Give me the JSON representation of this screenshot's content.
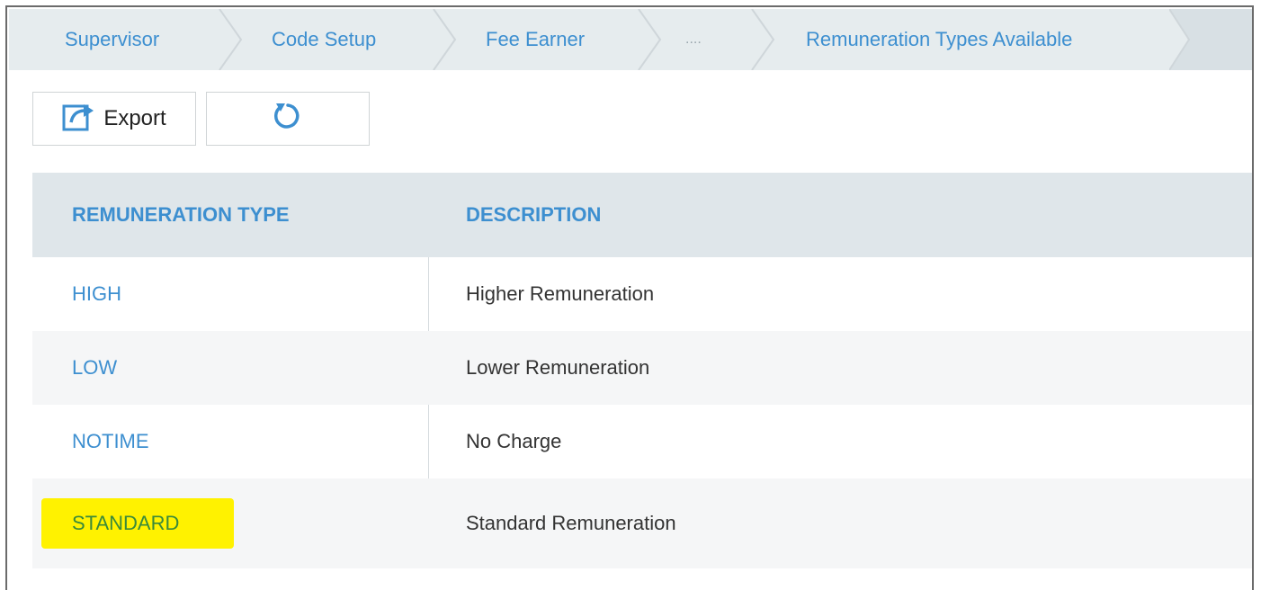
{
  "breadcrumb": {
    "items": [
      {
        "label": "Supervisor"
      },
      {
        "label": "Code Setup"
      },
      {
        "label": "Fee Earner"
      },
      {
        "label": "...."
      },
      {
        "label": "Remuneration Types Available"
      }
    ]
  },
  "toolbar": {
    "export_label": "Export",
    "export_icon": "export-icon",
    "refresh_icon": "refresh-icon"
  },
  "table": {
    "columns": [
      "REMUNERATION TYPE",
      "DESCRIPTION"
    ],
    "rows": [
      {
        "type": "HIGH",
        "description": "Higher Remuneration"
      },
      {
        "type": "LOW",
        "description": "Lower Remuneration"
      },
      {
        "type": "NOTIME",
        "description": "No Charge"
      },
      {
        "type": "STANDARD",
        "description": "Standard Remuneration",
        "highlighted": true
      }
    ]
  },
  "colors": {
    "accent": "#3d8fd0",
    "breadcrumb_bg": "#e6ecee",
    "header_bg": "#dfe6ea",
    "highlight": "#fff200"
  }
}
